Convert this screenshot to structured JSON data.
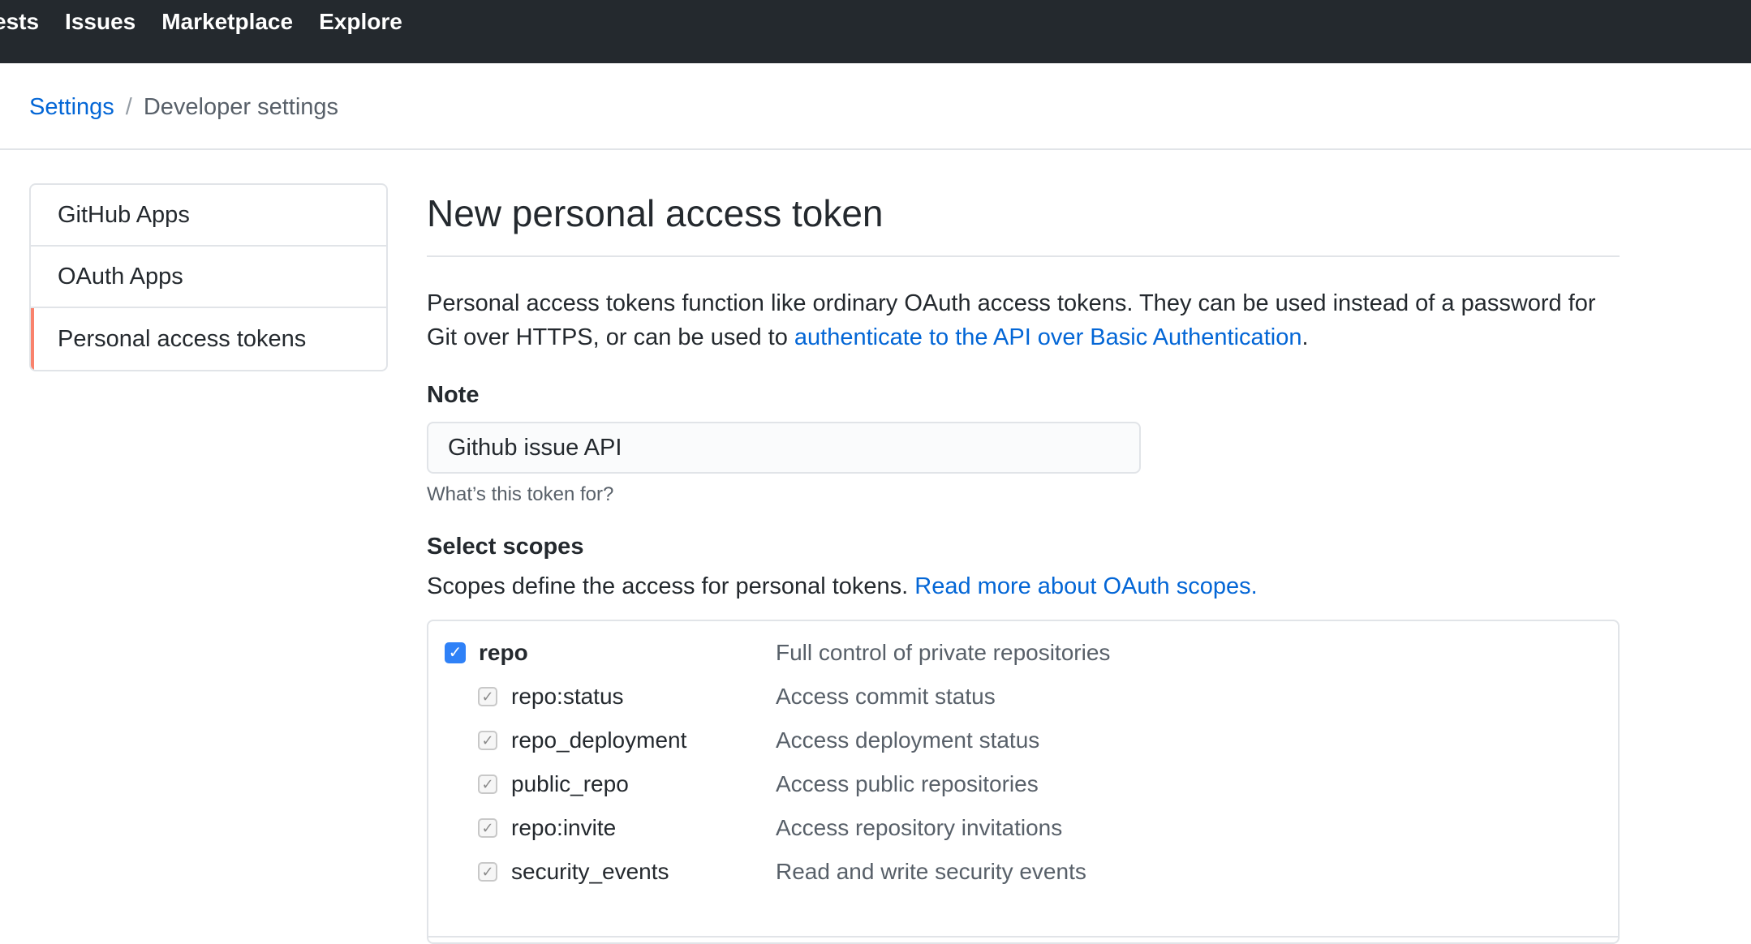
{
  "topnav": {
    "items": [
      "ests",
      "Issues",
      "Marketplace",
      "Explore"
    ]
  },
  "breadcrumb": {
    "parent": "Settings",
    "separator": "/",
    "current": "Developer settings"
  },
  "sidebar": {
    "items": [
      {
        "label": "GitHub Apps"
      },
      {
        "label": "OAuth Apps"
      },
      {
        "label": "Personal access tokens",
        "selected": true
      }
    ]
  },
  "main": {
    "title": "New personal access token",
    "description_prefix": "Personal access tokens function like ordinary OAuth access tokens. They can be used instead of a password for Git over HTTPS, or can be used to ",
    "description_link": "authenticate to the API over Basic Authentication",
    "description_suffix": ".",
    "note": {
      "label": "Note",
      "value": "Github issue API",
      "hint": "What’s this token for?"
    },
    "scopes": {
      "label": "Select scopes",
      "description": "Scopes define the access for personal tokens. ",
      "description_link": "Read more about OAuth scopes.",
      "items": [
        {
          "name": "repo",
          "description": "Full control of private repositories",
          "checked": true,
          "parent": true
        },
        {
          "name": "repo:status",
          "description": "Access commit status",
          "checked": true,
          "parent": false
        },
        {
          "name": "repo_deployment",
          "description": "Access deployment status",
          "checked": true,
          "parent": false
        },
        {
          "name": "public_repo",
          "description": "Access public repositories",
          "checked": true,
          "parent": false
        },
        {
          "name": "repo:invite",
          "description": "Access repository invitations",
          "checked": true,
          "parent": false
        },
        {
          "name": "security_events",
          "description": "Read and write security events",
          "checked": true,
          "parent": false
        }
      ]
    }
  },
  "colors": {
    "nav_bg": "#24292e",
    "link": "#0366d6",
    "selected_accent": "#f9826c",
    "checkbox_blue": "#2f81f7"
  },
  "icons": {
    "checked": "✓"
  }
}
